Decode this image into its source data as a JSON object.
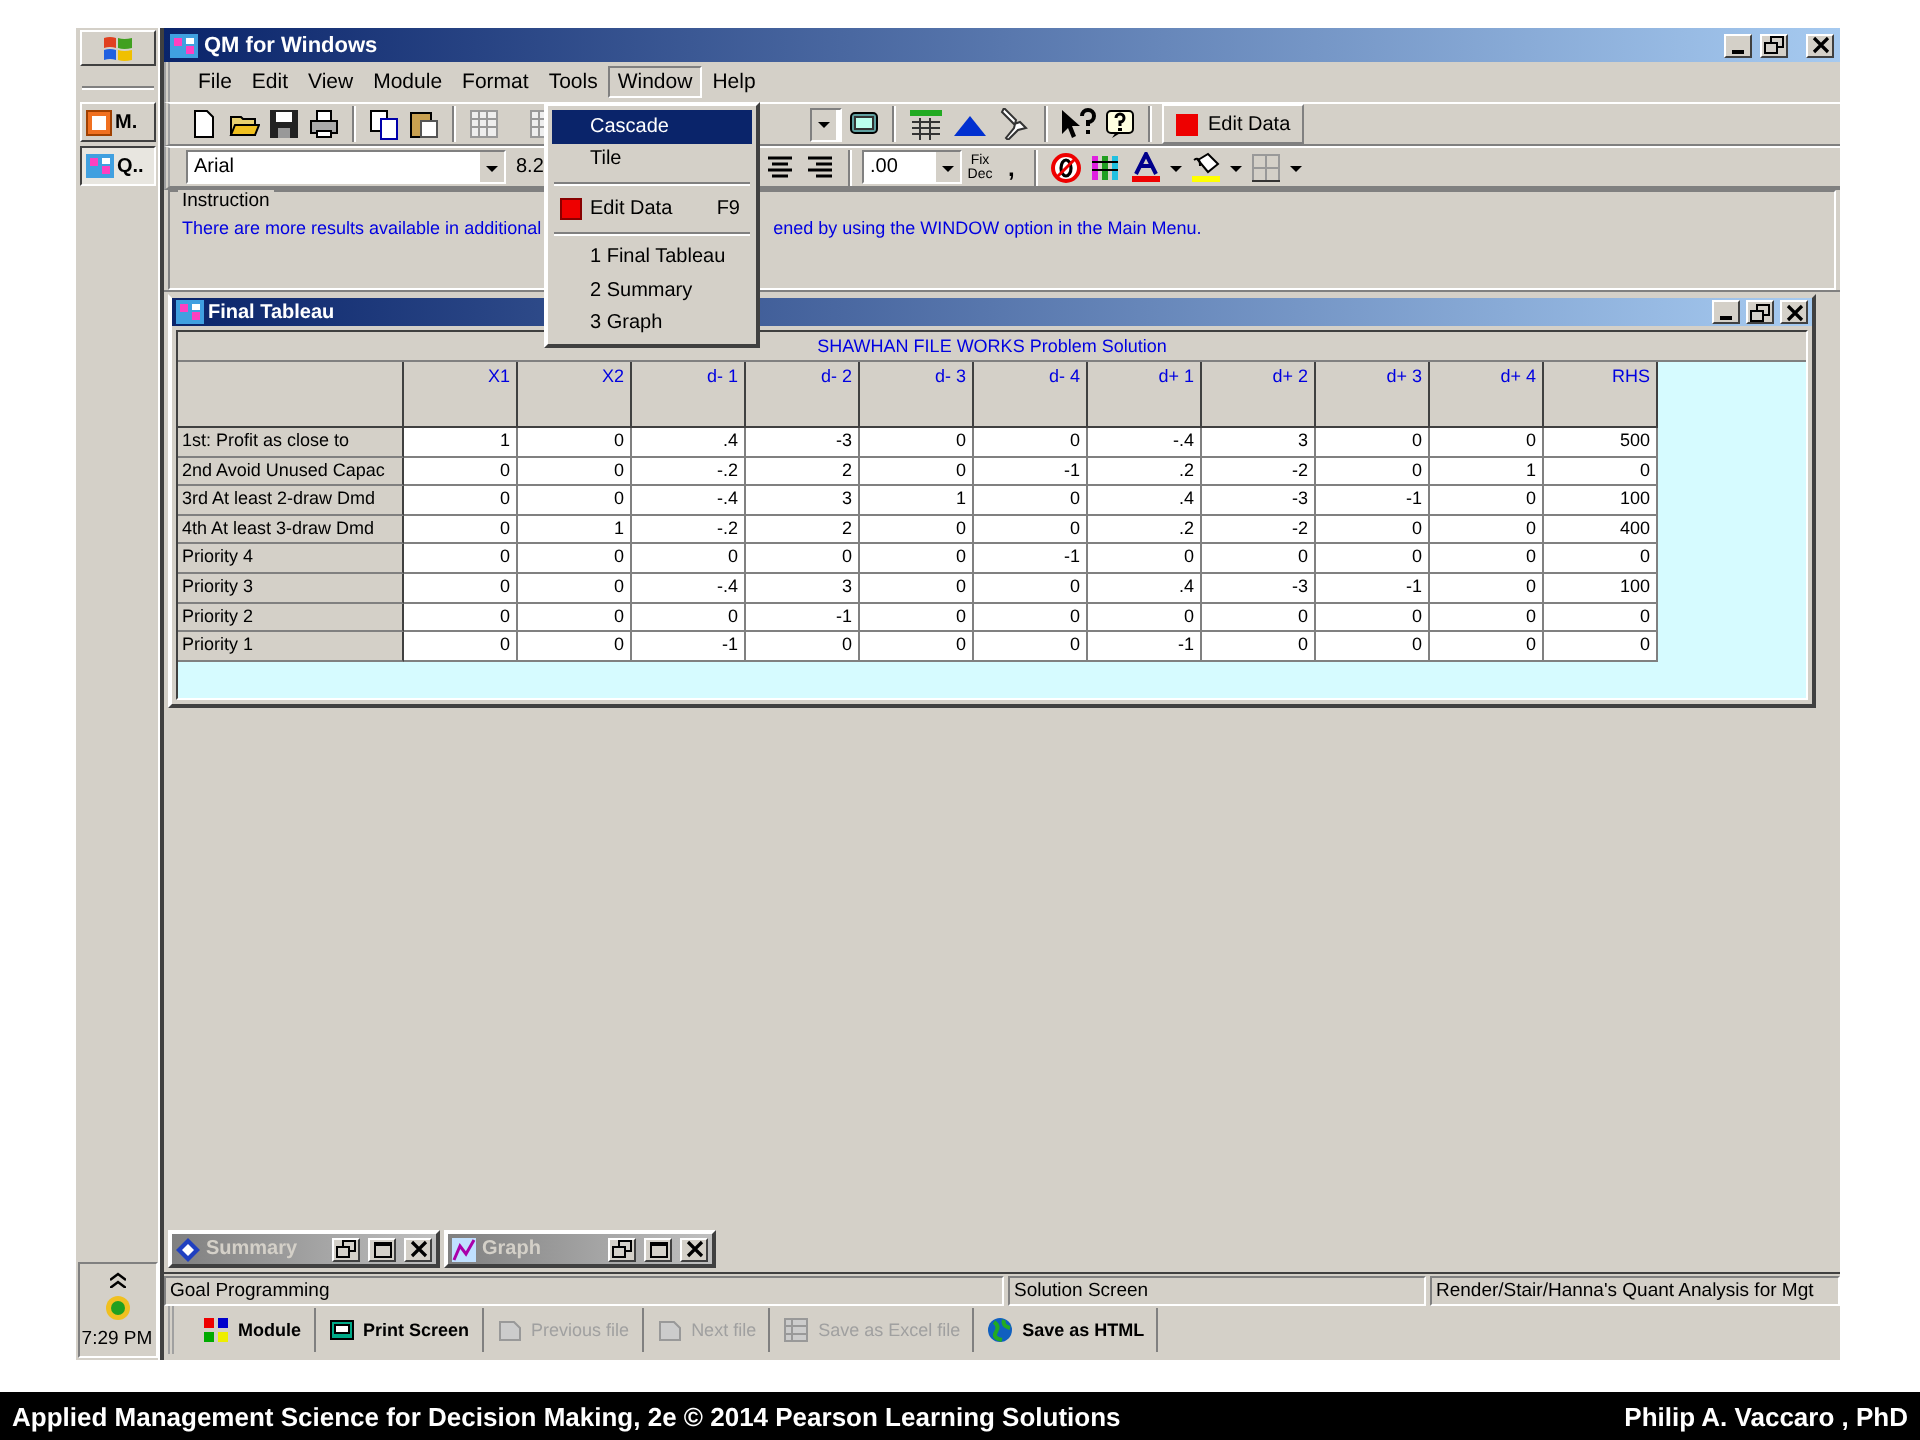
{
  "taskbar": {
    "buttons": [
      {
        "label": "M.",
        "selected": false
      },
      {
        "label": "Q..",
        "selected": true
      }
    ],
    "clock": "7:29 PM"
  },
  "window": {
    "title": "QM for Windows"
  },
  "menu_bar": [
    {
      "label": "File",
      "selected": false
    },
    {
      "label": "Edit",
      "selected": false
    },
    {
      "label": "View",
      "selected": false
    },
    {
      "label": "Module",
      "selected": false
    },
    {
      "label": "Format",
      "selected": false
    },
    {
      "label": "Tools",
      "selected": false
    },
    {
      "label": "Window",
      "selected": true
    },
    {
      "label": "Help",
      "selected": false
    }
  ],
  "window_menu": [
    {
      "kind": "item",
      "label": "Cascade",
      "selected": true
    },
    {
      "kind": "item",
      "label": "Tile",
      "selected": false
    },
    {
      "kind": "separator"
    },
    {
      "kind": "command",
      "label": "Edit Data",
      "shortcut": "F9",
      "selected": false
    },
    {
      "kind": "separator"
    },
    {
      "kind": "item",
      "label": "1 Final Tableau",
      "selected": false
    },
    {
      "kind": "item",
      "label": "2 Summary",
      "selected": false
    },
    {
      "kind": "item",
      "label": "3 Graph",
      "selected": false
    }
  ],
  "toolbar": {
    "edit_data_button": "Edit Data"
  },
  "format_bar": {
    "font": "Arial",
    "size": "8.2",
    "decimals": ".00",
    "fix_dec": "Fix Dec",
    "comma": ","
  },
  "instruction": {
    "legend": "Instruction",
    "text_left": "There are more results available in additional",
    "text_right": "ened by using the WINDOW option in the Main Menu."
  },
  "tableau": {
    "title": "Final Tableau",
    "caption": "SHAWHAN FILE WORKS Problem Solution",
    "columns": [
      "X1",
      "X2",
      "d- 1",
      "d- 2",
      "d- 3",
      "d- 4",
      "d+ 1",
      "d+ 2",
      "d+ 3",
      "d+ 4",
      "RHS"
    ],
    "rows": [
      {
        "label": "1st: Profit as close to",
        "cells": [
          "1",
          "0",
          ".4",
          "-3",
          "0",
          "0",
          "-.4",
          "3",
          "0",
          "0",
          "500"
        ]
      },
      {
        "label": "2nd Avoid Unused Capac",
        "cells": [
          "0",
          "0",
          "-.2",
          "2",
          "0",
          "-1",
          ".2",
          "-2",
          "0",
          "1",
          "0"
        ]
      },
      {
        "label": "3rd At least 2-draw Dmd",
        "cells": [
          "0",
          "0",
          "-.4",
          "3",
          "1",
          "0",
          ".4",
          "-3",
          "-1",
          "0",
          "100"
        ]
      },
      {
        "label": "4th At least 3-draw Dmd",
        "cells": [
          "0",
          "1",
          "-.2",
          "2",
          "0",
          "0",
          ".2",
          "-2",
          "0",
          "0",
          "400"
        ]
      },
      {
        "label": "Priority 4",
        "cells": [
          "0",
          "0",
          "0",
          "0",
          "0",
          "-1",
          "0",
          "0",
          "0",
          "0",
          "0"
        ]
      },
      {
        "label": "Priority 3",
        "cells": [
          "0",
          "0",
          "-.4",
          "3",
          "0",
          "0",
          ".4",
          "-3",
          "-1",
          "0",
          "100"
        ]
      },
      {
        "label": "Priority 2",
        "cells": [
          "0",
          "0",
          "0",
          "-1",
          "0",
          "0",
          "0",
          "0",
          "0",
          "0",
          "0"
        ]
      },
      {
        "label": "Priority 1",
        "cells": [
          "0",
          "0",
          "-1",
          "0",
          "0",
          "0",
          "-1",
          "0",
          "0",
          "0",
          "0"
        ]
      }
    ]
  },
  "minimized_windows": [
    {
      "title": "Summary"
    },
    {
      "title": "Graph"
    }
  ],
  "status_bar": [
    "Goal Programming",
    "Solution Screen",
    "Render/Stair/Hanna's Quant Analysis for Mgt"
  ],
  "bottom_toolbar": [
    {
      "label": "Module",
      "disabled": false
    },
    {
      "label": "Print Screen",
      "disabled": false
    },
    {
      "label": "Previous file",
      "disabled": true
    },
    {
      "label": "Next file",
      "disabled": true
    },
    {
      "label": "Save as Excel file",
      "disabled": true
    },
    {
      "label": "Save as HTML",
      "disabled": false
    }
  ],
  "footer": {
    "left": "Applied Management Science for Decision Making, 2e © 2014 Pearson Learning Solutions",
    "right": "Philip A. Vaccaro , PhD"
  }
}
